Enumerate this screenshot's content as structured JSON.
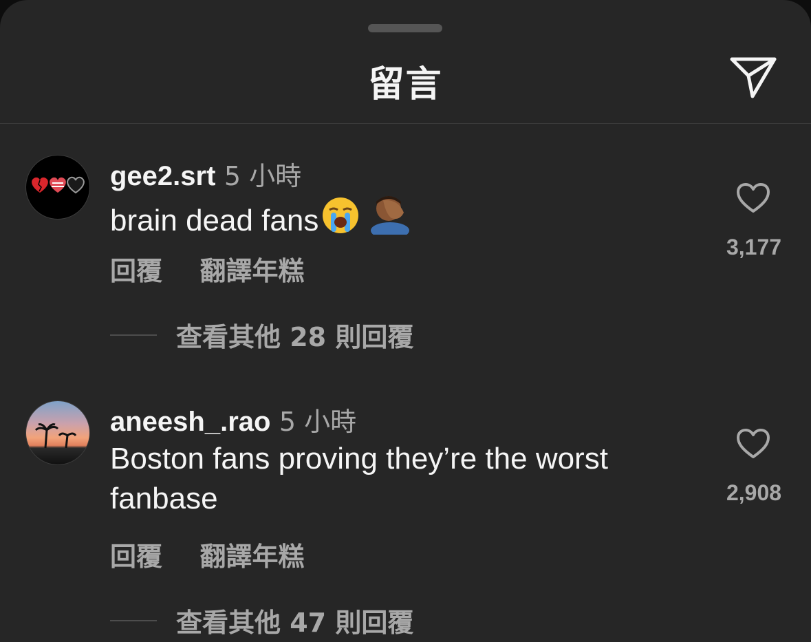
{
  "header": {
    "title": "留言",
    "share_icon": "paper-plane-icon"
  },
  "comments": [
    {
      "username": "gee2.srt",
      "time": "5 小時",
      "text": "brain dead fans",
      "emojis": [
        "loudly-crying-face",
        "man-facepalming-medium-dark"
      ],
      "reply_label": "回覆",
      "translate_label": "翻譯年糕",
      "likes": "3,177",
      "more_replies": "查看其他 28 則回覆",
      "avatar": "hearts-avatar"
    },
    {
      "username": "aneesh_.rao",
      "time": "5 小時",
      "text": "Boston fans proving they’re the worst fanbase",
      "reply_label": "回覆",
      "translate_label": "翻譯年糕",
      "likes": "2,908",
      "more_replies": "查看其他 47 則回覆",
      "avatar": "sunset-palms-avatar"
    }
  ],
  "colors": {
    "background": "#262626",
    "primary_text": "#f5f5f5",
    "secondary_text": "#a8a8a8"
  }
}
